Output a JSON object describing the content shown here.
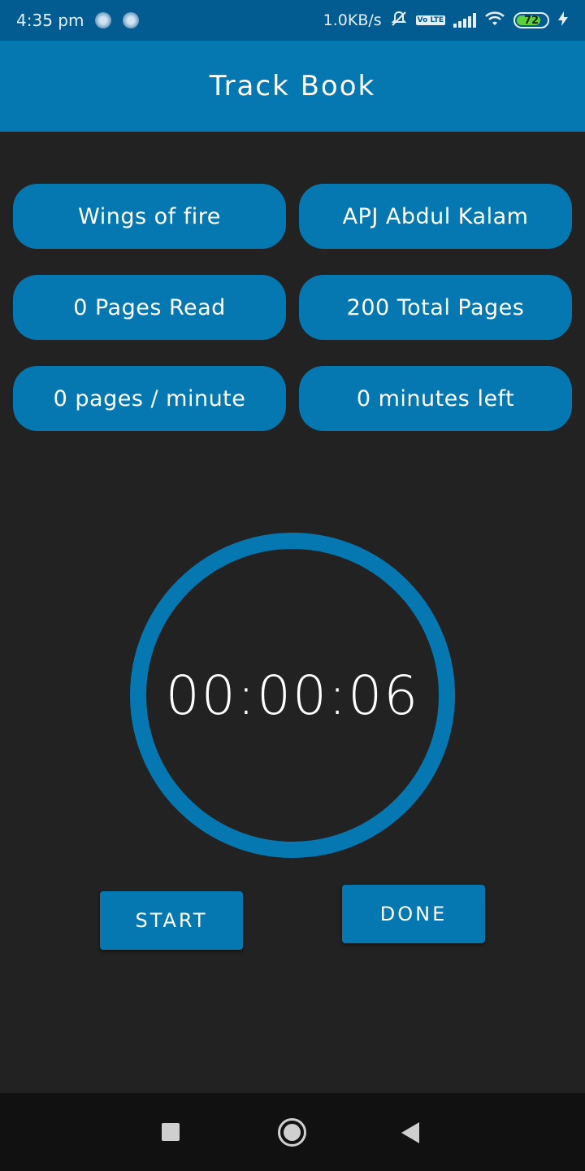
{
  "status_bar": {
    "time": "4:35 pm",
    "network_speed": "1.0KB/s",
    "volte": "Vo LTE",
    "battery_level": "72",
    "icons": [
      "sync-icon",
      "sync-icon",
      "mute-icon",
      "volte-icon",
      "signal-icon",
      "wifi-icon",
      "battery-icon",
      "charging-icon"
    ]
  },
  "app_bar": {
    "title": "Track Book"
  },
  "info": {
    "book_title": "Wings of fire",
    "author": "APJ Abdul Kalam",
    "pages_read": "0 Pages Read",
    "total_pages": "200 Total Pages",
    "reading_speed": "0 pages / minute",
    "time_left": "0 minutes left"
  },
  "timer": {
    "display": "00:00:06"
  },
  "buttons": {
    "start_label": "START",
    "done_label": "DONE"
  },
  "nav": {
    "icons": [
      "recents-icon",
      "home-icon",
      "back-icon"
    ]
  },
  "colors": {
    "accent": "#0577b1",
    "status_bar": "#025c91",
    "background": "#222222",
    "nav_bar": "#111111"
  }
}
